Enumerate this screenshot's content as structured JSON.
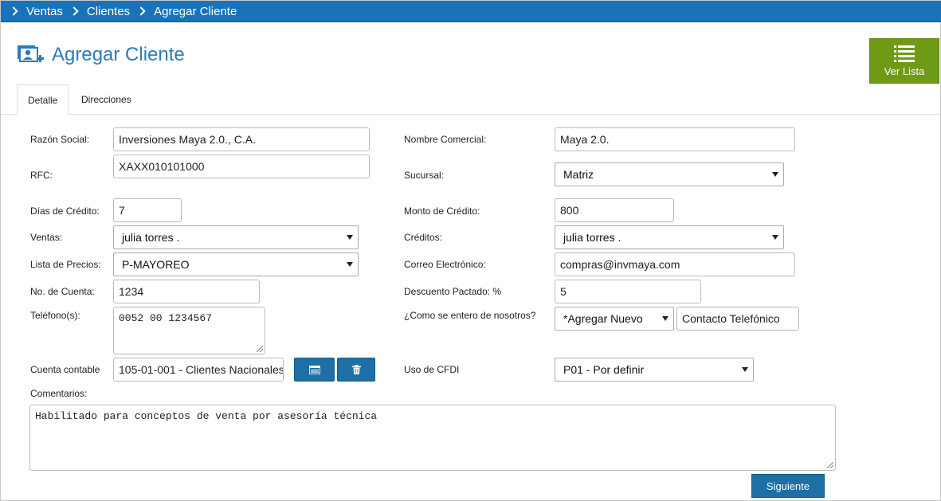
{
  "breadcrumb": [
    "Ventas",
    "Clientes",
    "Agregar Cliente"
  ],
  "title": "Agregar Cliente",
  "ver_lista": "Ver Lista",
  "tabs": {
    "detalle": "Detalle",
    "direcciones": "Direcciones"
  },
  "form": {
    "razon_social_label": "Razón Social:",
    "razon_social_value": "Inversiones Maya 2.0., C.A.",
    "nombre_comercial_label": "Nombre Comercial:",
    "nombre_comercial_value": "Maya 2.0.",
    "rfc_label": "RFC:",
    "rfc_value": "XAXX010101000",
    "sucursal_label": "Sucursal:",
    "sucursal_value": "Matriz",
    "dias_credito_label": "Días de Crédito:",
    "dias_credito_value": "7",
    "monto_credito_label": "Monto de Crédito:",
    "monto_credito_value": "800",
    "ventas_label": "Ventas:",
    "ventas_value": "julia torres .",
    "creditos_label": "Créditos:",
    "creditos_value": "julia torres .",
    "lista_precios_label": "Lista de Precios:",
    "lista_precios_value": "P-MAYOREO",
    "correo_label": "Correo Electrónico:",
    "correo_value": "compras@invmaya.com",
    "no_cuenta_label": "No. de Cuenta:",
    "no_cuenta_value": "1234",
    "descuento_label": "Descuento Pactado: %",
    "descuento_value": "5",
    "telefonos_label": "Teléfono(s):",
    "telefonos_value": "0052 00 1234567",
    "como_entero_label": "¿Como se entero de nosotros?",
    "como_entero_select": "*Agregar Nuevo",
    "como_entero_value": "Contacto Telefónico",
    "cuenta_contable_label": "Cuenta contable",
    "cuenta_contable_value": "105-01-001 - Clientes Nacionales",
    "uso_cfdi_label": "Uso de CFDI",
    "uso_cfdi_value": "P01 - Por definir",
    "comentarios_label": "Comentarios:",
    "comentarios_value": "Habilitado para conceptos de venta por asesoría técnica"
  },
  "siguiente": "Siguiente",
  "colors": {
    "header_blue": "#1a73b8",
    "title_blue": "#2b7bba",
    "green": "#6f9a16",
    "button_blue": "#1d6fa5"
  }
}
